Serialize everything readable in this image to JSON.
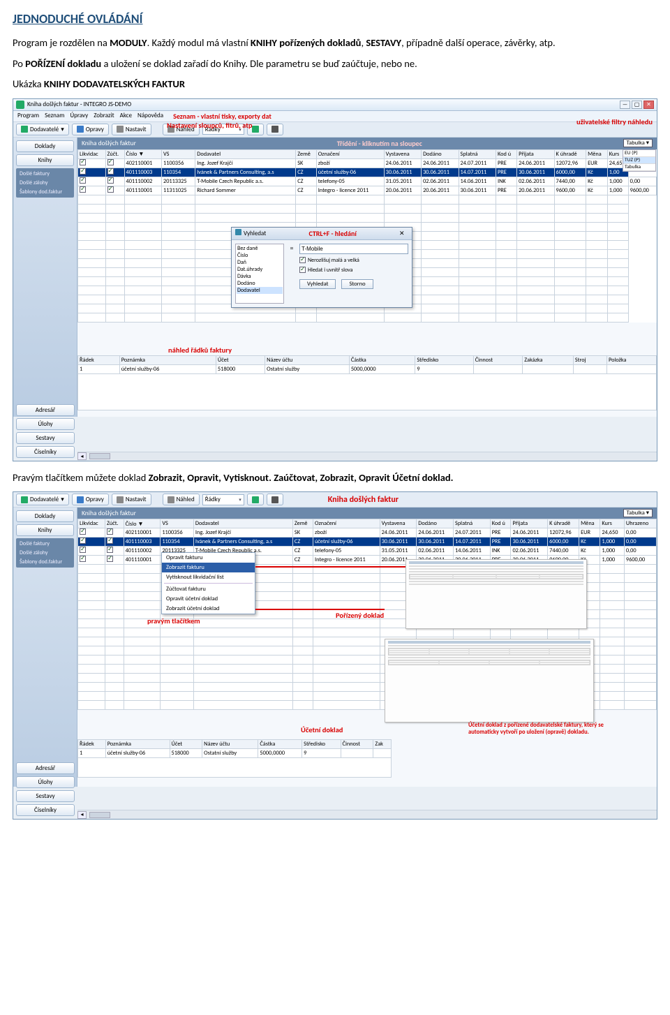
{
  "heading": "JEDNODUCHÉ OVLÁDÁNÍ",
  "p1_a": "Program je rozdělen na ",
  "p1_b": "MODULY",
  "p1_c": ". Každý modul má vlastní ",
  "p1_d": "KNIHY pořízených dokladů",
  "p1_e": ", ",
  "p1_f": "SESTAVY",
  "p1_g": ", případně další operace, závěrky, atp.",
  "p2_a": "Po ",
  "p2_b": "POŘÍZENÍ dokladu",
  "p2_c": " a uložení se doklad zařadí do Knihy. Dle parametru se buď zaúčtuje, nebo ne.",
  "p3_a": "Ukázka ",
  "p3_b": "KNIHY DODAVATELSKÝCH FAKTUR",
  "p4_a": "Pravým tlačítkem můžete doklad ",
  "p4_b": "Zobrazit, Opravit, Vytisknout. Zaúčtovat, Zobrazit, Opravit Účetní doklad.",
  "shot1": {
    "title": "Kniha došlých faktur - INTEGRO JS-DEMO",
    "menu": [
      "Program",
      "Seznam",
      "Úpravy",
      "Zobrazit",
      "Akce",
      "Nápověda"
    ],
    "ann_menu": "Seznam - vlastní tisky, exporty dat",
    "ann_nast": "Nastavení sloupců, fitrů, atp",
    "ann_sort": "Třídění - kliknutím na sloupec",
    "ann_filters": "uživatelské filtry náhledu",
    "ann_ctrlf": "CTRL+F - hledání",
    "ann_detail": "náhled řádků faktury",
    "toolbar": {
      "module": "Dodavatelé",
      "opravy": "Opravy",
      "nastavit": "Nastavit",
      "nahled": "Náhled",
      "field": "Řádky"
    },
    "sidebar": {
      "doklady": "Doklady",
      "knihy": "Knihy",
      "sub": [
        "Došlé faktury",
        "Došlé zálohy",
        "Šablony dod.faktur"
      ],
      "bottom": [
        "Adresář",
        "Úlohy",
        "Sestavy",
        "Číselníky"
      ]
    },
    "kniha_hdr": "Kniha došlých faktur",
    "tabulka": "Tabulka",
    "filters": [
      "EU (P)",
      "TUZ (P)",
      "Tabulka"
    ],
    "columns": [
      "Likvidac",
      "Zúčt.",
      "Číslo ▼",
      "VS",
      "Dodavatel",
      "Země",
      "Označení",
      "Vystavena",
      "Dodáno",
      "Splatná",
      "Kod ú",
      "Přijata",
      "K úhradě",
      "Měna",
      "Kurs"
    ],
    "rows": [
      {
        "c": [
          "",
          "",
          "402110001",
          "1100356",
          "Ing. Jozef Krajčí",
          "SK",
          "zboží",
          "24.06.2011",
          "24.06.2011",
          "24.07.2011",
          "PRE",
          "24.06.2011",
          "12072,96",
          "EUR",
          "24,65"
        ]
      },
      {
        "c": [
          "",
          "",
          "401110003",
          "110354",
          "Ivánek & Partners Consulting, a.s",
          "CZ",
          "účetní služby-06",
          "30.06.2011",
          "30.06.2011",
          "14.07.2011",
          "PRE",
          "30.06.2011",
          "6000,00",
          "Kč",
          "1,00"
        ],
        "sel": true
      },
      {
        "c": [
          "",
          "",
          "401110002",
          "20113325",
          "T-Mobile Czech Republic a.s.",
          "CZ",
          "telefony-05",
          "31.05.2011",
          "02.06.2011",
          "14.06.2011",
          "INK",
          "02.06.2011",
          "7440,00",
          "Kč",
          "1,000",
          "0,00"
        ]
      },
      {
        "c": [
          "",
          "",
          "401110001",
          "11311025",
          "Richard Sommer",
          "CZ",
          "Integro - licence 2011",
          "20.06.2011",
          "20.06.2011",
          "30.06.2011",
          "PRE",
          "20.06.2011",
          "9600,00",
          "Kč",
          "1,000",
          "9600,00"
        ]
      }
    ],
    "detail_cols": [
      "Řádek",
      "Poznámka",
      "Účet",
      "Název účtu",
      "Částka",
      "Středisko",
      "Činnost",
      "Zakázka",
      "Stroj",
      "Položka"
    ],
    "detail_row": [
      "1",
      "účetní služby-06",
      "518000",
      "Ostatní služby",
      "5000,0000",
      "9",
      "",
      "",
      "",
      ""
    ],
    "dlg": {
      "title": "Vyhledat",
      "list": [
        "Bez daně",
        "Číslo",
        "Daň",
        "Dat.úhrady",
        "Dávka",
        "Dodáno",
        "Dodavatel"
      ],
      "eq": "=",
      "val": "T-Mobile",
      "c1": "Nerozlišuj malá a velká",
      "c2": "Hledat i uvnitř slova",
      "b1": "Vyhledat",
      "b2": "Storno"
    }
  },
  "shot2": {
    "toolbar": {
      "module": "Dodavatelé",
      "opravy": "Opravy",
      "nastavit": "Nastavit",
      "nahled": "Náhled",
      "field": "Řádky"
    },
    "sidebar": {
      "doklady": "Doklady",
      "knihy": "Knihy",
      "sub": [
        "Došlé faktury",
        "Došlé zálohy",
        "Šablony dod.faktur"
      ],
      "bottom": [
        "Adresář",
        "Úlohy",
        "Sestavy",
        "Číselníky"
      ]
    },
    "kniha_hdr": "Kniha došlých faktur",
    "ann_hdr": "Kniha došlých faktur",
    "tabulka": "Tabulka",
    "columns": [
      "Likvidac",
      "Zúčt.",
      "Číslo ▼",
      "VS",
      "Dodavatel",
      "Země",
      "Označení",
      "Vystavena",
      "Dodáno",
      "Splatná",
      "Kod ú",
      "Přijata",
      "K úhradě",
      "Měna",
      "Kurs",
      "Uhrazeno"
    ],
    "rows": [
      {
        "c": [
          "",
          "",
          "402110001",
          "1100356",
          "Ing. Jozef Krajčí",
          "SK",
          "zboží",
          "24.06.2011",
          "24.06.2011",
          "24.07.2011",
          "PRE",
          "24.06.2011",
          "12072,96",
          "EUR",
          "24,650",
          "0,00"
        ]
      },
      {
        "c": [
          "",
          "",
          "401110003",
          "110354",
          "Ivánek & Partners Consulting, a.s",
          "CZ",
          "účetní služby-06",
          "30.06.2011",
          "30.06.2011",
          "14.07.2011",
          "PRE",
          "30.06.2011",
          "6000,00",
          "Kč",
          "1,000",
          "0,00"
        ],
        "sel": true
      },
      {
        "c": [
          "",
          "",
          "401110002",
          "20113325",
          "T-Mobile Czech Republic a.s.",
          "CZ",
          "telefony-05",
          "31.05.2011",
          "02.06.2011",
          "14.06.2011",
          "INK",
          "02.06.2011",
          "7440,00",
          "Kč",
          "1,000",
          "0,00"
        ]
      },
      {
        "c": [
          "",
          "",
          "401110001",
          "11311025",
          "Richard Sommer",
          "CZ",
          "Integro - licence 2011",
          "20.06.2011",
          "20.06.2011",
          "30.06.2011",
          "PRE",
          "20.06.2011",
          "9600,00",
          "Kč",
          "1,000",
          "9600,00"
        ]
      }
    ],
    "ctx": [
      "Opravit fakturu",
      "Zobrazit fakturu",
      "Vytisknout likvidační list",
      "Zúčtovat fakturu",
      "Opravit účetní doklad",
      "Zobrazit účetní doklad"
    ],
    "ann_ctx": "pravým tlačítkem",
    "ann_doc1": "Pořízený doklad",
    "ann_doc2": "Účetní doklad",
    "ann_note": "Účetní doklad z pořízené dodavatelské faktury, který se automaticky vytvoří po uložení (opravě) dokladu.",
    "detail_cols": [
      "Řádek",
      "Poznámka",
      "Účet",
      "Název účtu",
      "Částka",
      "Středisko",
      "Činnost",
      "Zak"
    ],
    "detail_row": [
      "1",
      "účetní služby-06",
      "518000",
      "Ostatní služby",
      "5000,0000",
      "9",
      "",
      ""
    ]
  }
}
